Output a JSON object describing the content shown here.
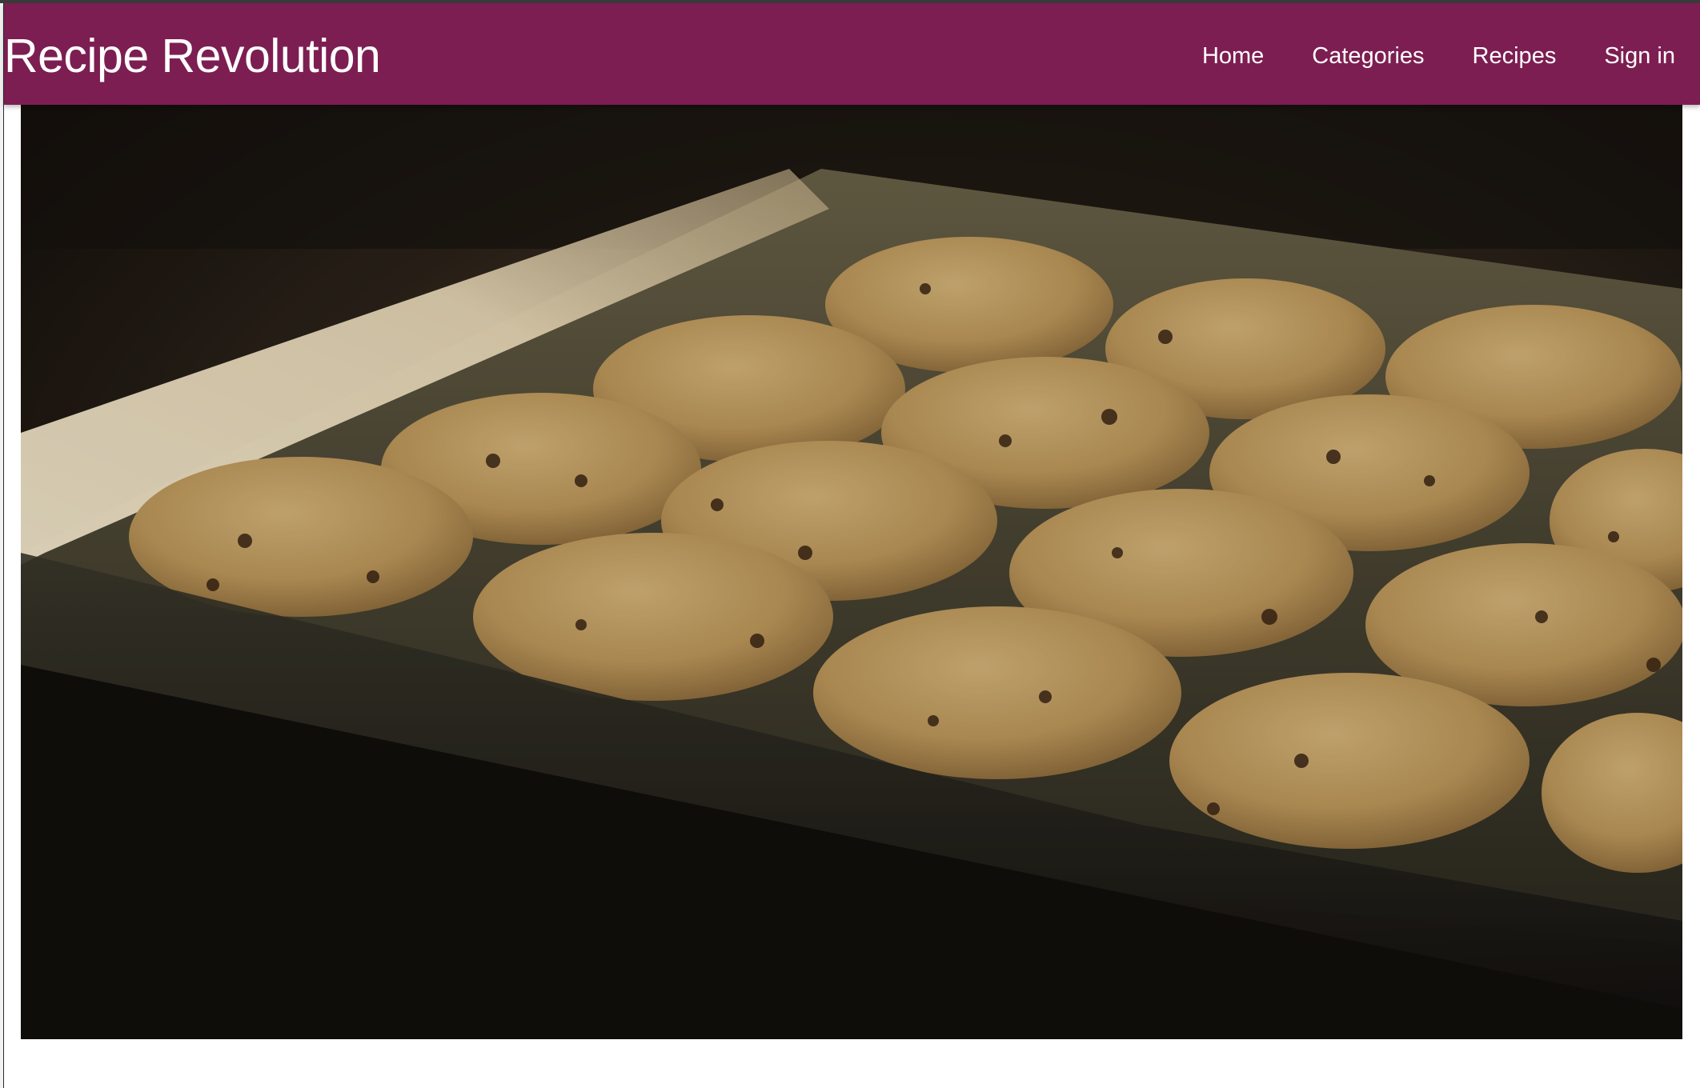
{
  "brand": {
    "name": "Recipe Revolution"
  },
  "nav": {
    "items": [
      {
        "label": "Home"
      },
      {
        "label": "Categories"
      },
      {
        "label": "Recipes"
      },
      {
        "label": "Sign in"
      }
    ]
  },
  "hero": {
    "image_icon": "hero-photo-cookies-in-oven"
  },
  "colors": {
    "navbar": "#7d1e52",
    "nav_text": "#ffffff",
    "page_background": "#ffffff"
  }
}
